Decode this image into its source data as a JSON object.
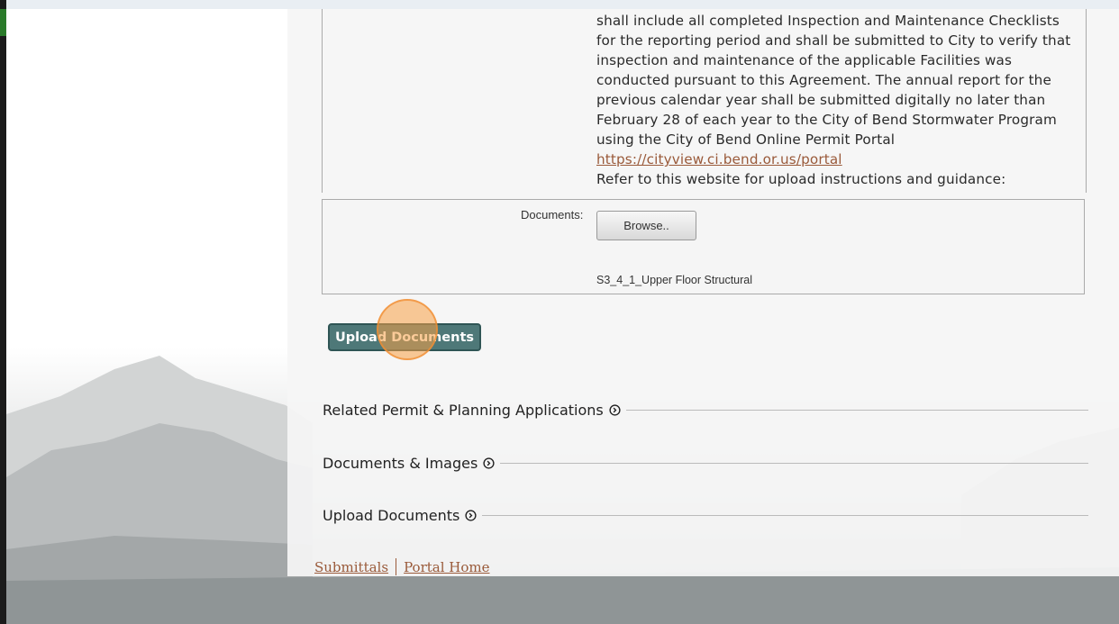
{
  "agreement_text": {
    "lines": [
      "shall include all completed Inspection and Maintenance Checklists",
      "for the reporting period and shall be submitted to City to verify that",
      "inspection and maintenance of the applicable Facilities was",
      "conducted pursuant to this Agreement. The annual report for the",
      "previous calendar year shall be submitted digitally no later than",
      "February 28 of each year to the City of Bend Stormwater Program",
      "using the City of Bend Online Permit Portal"
    ],
    "portal_link": "https://cityview.ci.bend.or.us/portal",
    "instructions": "Refer to this website for upload instructions and guidance:"
  },
  "documents": {
    "label": "Documents:",
    "browse_label": "Browse..",
    "file_name": "S3_4_1_Upper Floor Structural"
  },
  "upload_button_label": "Upload Documents",
  "sections": [
    {
      "title": "Related Permit & Planning Applications"
    },
    {
      "title": "Documents & Images"
    },
    {
      "title": "Upload Documents"
    }
  ],
  "footer": {
    "submittals": "Submittals",
    "portal_home": "Portal Home"
  },
  "colors": {
    "button_teal": "#4e7878",
    "link_brown": "#9a5a3a",
    "click_marker": "#f7a046"
  }
}
